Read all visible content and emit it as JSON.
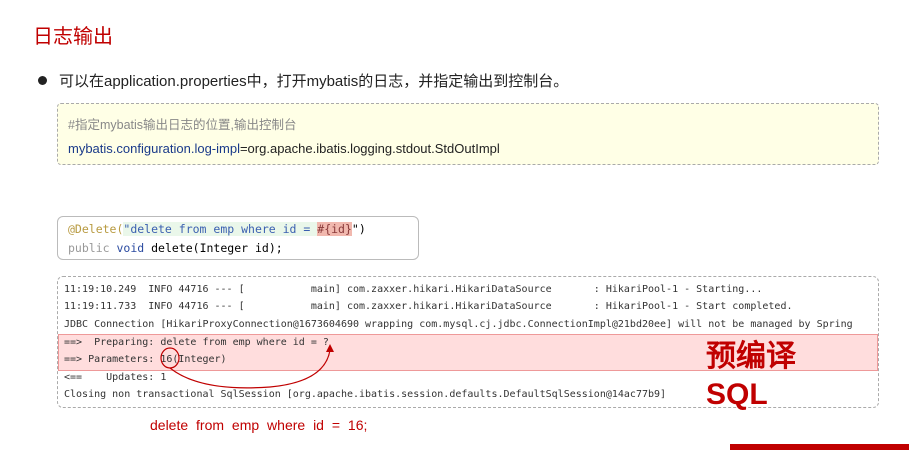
{
  "title": "日志输出",
  "bullet": "可以在application.properties中，打开mybatis的日志，并指定输出到控制台。",
  "config": {
    "comment": "#指定mybatis输出日志的位置,输出控制台",
    "key": "mybatis.configuration.log-impl",
    "value": "=org.apache.ibatis.logging.stdout.StdOutImpl"
  },
  "code": {
    "annotation": "@Delete(",
    "str": "\"delete from emp where id = ",
    "param": "#{id}",
    "end": "\")",
    "line2_kw1": "public",
    "line2_kw2": "void",
    "line2_rest": "delete(Integer id);"
  },
  "log": [
    "11:19:10.249  INFO 44716 --- [           main] com.zaxxer.hikari.HikariDataSource       : HikariPool-1 - Starting...",
    "11:19:11.733  INFO 44716 --- [           main] com.zaxxer.hikari.HikariDataSource       : HikariPool-1 - Start completed.",
    "JDBC Connection [HikariProxyConnection@1673604690 wrapping com.mysql.cj.jdbc.ConnectionImpl@21bd20ee] will not be managed by Spring",
    "==>  Preparing: delete from emp where id = ?",
    "==> Parameters: 16(Integer)",
    "<==    Updates: 1",
    "Closing non transactional SqlSession [org.apache.ibatis.session.defaults.DefaultSqlSession@14ac77b9]"
  ],
  "precompiled_label_1": "预编译",
  "precompiled_label_2": "SQL",
  "final_sql": "delete from emp where id = 16;",
  "colors": {
    "accent": "#c00000"
  }
}
